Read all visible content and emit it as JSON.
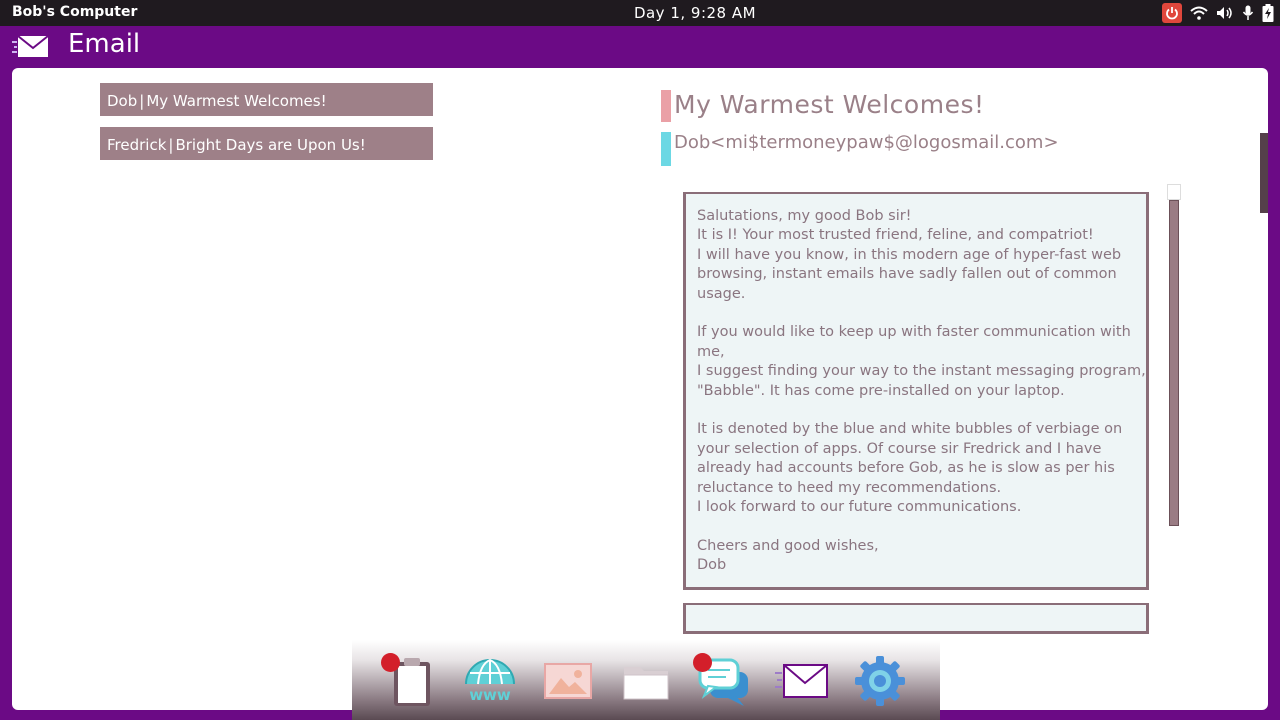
{
  "system": {
    "computer_name": "Bob's Computer",
    "clock": "Day 1, 9:28 AM",
    "tray_icons": [
      "power-icon",
      "wifi-icon",
      "volume-icon",
      "microphone-icon",
      "battery-icon"
    ]
  },
  "app": {
    "title": "Email",
    "icon": "envelope-icon"
  },
  "inbox": [
    {
      "sender": "Dob",
      "separator": "|",
      "subject": "My Warmest Welcomes!"
    },
    {
      "sender": "Fredrick",
      "separator": "|",
      "subject": "Bright Days are Upon Us!"
    }
  ],
  "message": {
    "subject": "My Warmest Welcomes!",
    "from": "Dob<mi$termoneypaw$@logosmail.com>",
    "body": "Salutations, my good Bob sir!\nIt is I! Your most trusted friend, feline, and compatriot!\nI will have you know, in this modern age of hyper-fast web\nbrowsing, instant emails have sadly fallen out of common\nusage.\n\nIf you would like to keep up with faster communication with me,\nI suggest finding your way to the instant messaging program,\n\"Babble\". It has come pre-installed on your laptop.\n\nIt is denoted by the blue and white bubbles of verbiage on\nyour selection of apps. Of course sir Fredrick and I have\nalready had accounts before Gob, as he is slow as per his\nreluctance to heed my recommendations.\nI look forward to our future communications.\n\nCheers and good wishes,\nDob"
  },
  "dock": [
    {
      "name": "clipboard-icon",
      "notification": true
    },
    {
      "name": "web-browser-icon",
      "notification": false
    },
    {
      "name": "image-viewer-icon",
      "notification": false
    },
    {
      "name": "folder-icon",
      "notification": false
    },
    {
      "name": "chat-bubbles-icon",
      "notification": true
    },
    {
      "name": "email-icon",
      "notification": false
    },
    {
      "name": "settings-gear-icon",
      "notification": false
    }
  ],
  "colors": {
    "frame": "#6b0a85",
    "topbar": "#1f1a1f",
    "mail_item": "#9e8088",
    "text_muted": "#9a8088",
    "subject_accent": "#eaa0a6",
    "sender_accent": "#6cd8e4",
    "body_bg": "#eef5f6",
    "badge": "#d31f2a"
  }
}
